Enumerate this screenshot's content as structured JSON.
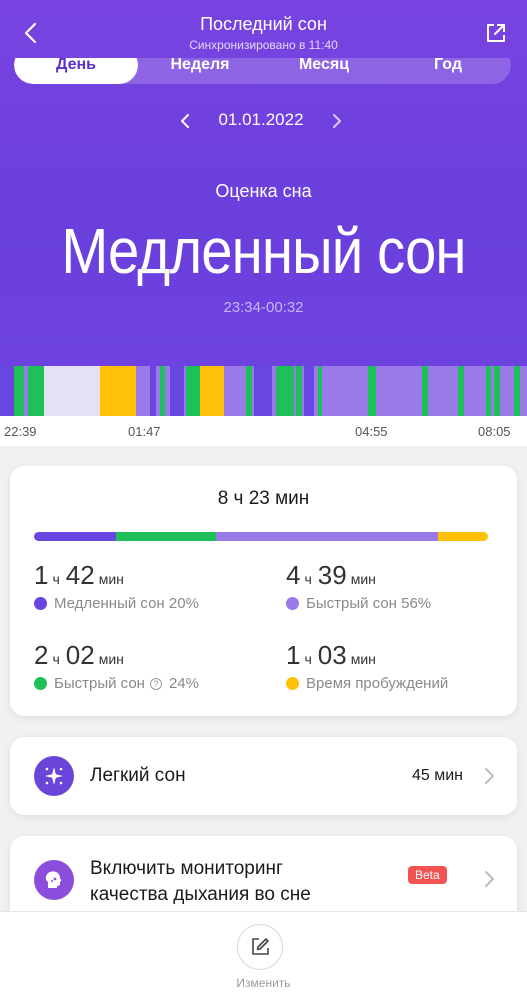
{
  "header": {
    "title": "Последний сон",
    "subtitle": "Синхронизировано в 11:40",
    "back_icon": "chevron-left-icon",
    "share_icon": "external-share-icon"
  },
  "tabs": [
    {
      "label": "День",
      "active": true
    },
    {
      "label": "Неделя",
      "active": false
    },
    {
      "label": "Месяц",
      "active": false
    },
    {
      "label": "Год",
      "active": false
    }
  ],
  "date": {
    "value": "01.01.2022"
  },
  "hero": {
    "score_label": "Оценка сна",
    "stage": "Медленный сон",
    "time_range": "23:34-00:32"
  },
  "timeline": {
    "ticks": [
      "22:39",
      "01:47",
      "04:55",
      "08:05"
    ]
  },
  "colors": {
    "deep": "#6a46e0",
    "light_fast": "#1ec05a",
    "rem": "#9a7ae8",
    "awake": "#ffc107",
    "highlight": "#e6e0f6",
    "accent": "#6b45d8"
  },
  "summary": {
    "total": "8 ч 23 мин",
    "stats": [
      {
        "h": "1",
        "h_unit": "ч",
        "m": "42",
        "m_unit": "мин",
        "label": "Медленный сон 20%",
        "color": "#6a46e0",
        "share": 20,
        "help": false
      },
      {
        "h": "4",
        "h_unit": "ч",
        "m": "39",
        "m_unit": "мин",
        "label": "Быстрый сон 56%",
        "color": "#9a7ae8",
        "share": 56,
        "help": false
      },
      {
        "h": "2",
        "h_unit": "ч",
        "m": "02",
        "m_unit": "мин",
        "label": "Быстрый сон",
        "pct": "24%",
        "color": "#1ec05a",
        "share": 24,
        "help": true
      },
      {
        "h": "1",
        "h_unit": "ч",
        "m": "03",
        "m_unit": "мин",
        "label": "Время пробуждений",
        "color": "#ffc107",
        "share": 12,
        "help": false
      }
    ]
  },
  "cards": {
    "light_sleep": {
      "label": "Легкий сон",
      "value": "45 мин",
      "icon": "sparkle-icon"
    },
    "breathing": {
      "label_line1": "Включить мониторинг",
      "label_line2": "качества дыхания во сне",
      "badge": "Beta",
      "icon": "breathing-face-icon"
    }
  },
  "bottom": {
    "edit_label": "Изменить",
    "edit_icon": "edit-icon"
  }
}
